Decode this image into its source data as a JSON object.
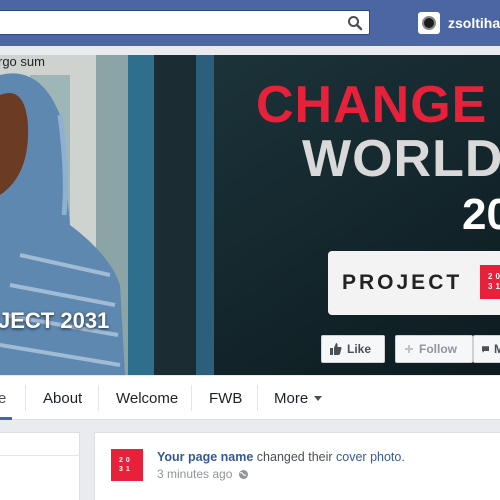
{
  "topbar": {
    "search_placeholder": "",
    "profile_name": "zsoltihasz"
  },
  "cover": {
    "headline_1": "CHANGE",
    "headline_2": "WORLD",
    "headline_3": "20",
    "project_label": "PROJECT",
    "badge_line_1": "20",
    "badge_line_2": "31",
    "page_title": "JECT 2031",
    "like_label": "Like",
    "follow_label": "Follow",
    "message_label": "M"
  },
  "tabs": [
    {
      "label": "e"
    },
    {
      "label": "About"
    },
    {
      "label": "Welcome"
    },
    {
      "label": "FWB"
    },
    {
      "label": "More"
    }
  ],
  "left_card": {
    "text": "rgo sum"
  },
  "post": {
    "logo_line_1": "20",
    "logo_line_2": "31",
    "author": "Your page name",
    "action": " changed their ",
    "object": "cover photo",
    "end": ".",
    "time": "3 minutes ago"
  },
  "colors": {
    "topbar": "#4b66a2",
    "accent_red": "#e8213a",
    "link_blue": "#365899"
  }
}
